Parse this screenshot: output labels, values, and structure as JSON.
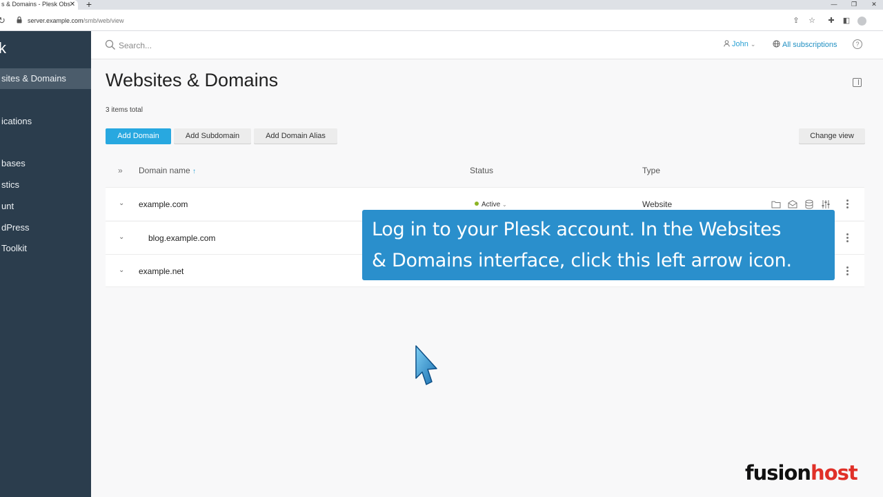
{
  "browser": {
    "tab_title": "s & Domains - Plesk Obs",
    "tab_close": "✕",
    "new_tab": "+",
    "url_host": "server.example.com",
    "url_path": "/smb/web/view",
    "window_controls": [
      "—",
      "❐",
      "✕"
    ]
  },
  "sidebar": {
    "logo": "k",
    "items": [
      {
        "label": "sites & Domains",
        "active": true
      },
      {
        "label": "ications",
        "active": false
      },
      {
        "label": "bases",
        "active": false
      },
      {
        "label": "stics",
        "active": false
      },
      {
        "label": "unt",
        "active": false
      },
      {
        "label": "dPress",
        "active": false
      },
      {
        "label": "Toolkit",
        "active": false
      }
    ],
    "collapse_icon": "‹"
  },
  "topbar": {
    "search_placeholder": "Search...",
    "user": "John",
    "subscriptions": "All subscriptions",
    "help": "?"
  },
  "page": {
    "title": "Websites & Domains",
    "items_total": "3 items total"
  },
  "toolbar": {
    "add_domain": "Add Domain",
    "add_subdomain": "Add Subdomain",
    "add_domain_alias": "Add Domain Alias",
    "change_view": "Change view"
  },
  "table": {
    "columns": {
      "domain_name": "Domain name",
      "sort_arrow": "↑",
      "status": "Status",
      "type": "Type"
    },
    "rows": [
      {
        "name": "example.com",
        "status": "Active",
        "type": "Website",
        "indent": false
      },
      {
        "name": "blog.example.com",
        "status": "",
        "type": "",
        "indent": true
      },
      {
        "name": "example.net",
        "status": "",
        "type": "",
        "indent": false
      }
    ]
  },
  "callout": {
    "line1": "Log in to your Plesk account. In the Websites",
    "line2": "& Domains interface, click this left arrow icon."
  },
  "brand": {
    "part1": "fusion",
    "part2": "host"
  },
  "colors": {
    "sidebar": "#2b3d4d",
    "primary": "#28a8e0",
    "callout": "#2a8fcc",
    "status_active": "#8cb424"
  }
}
